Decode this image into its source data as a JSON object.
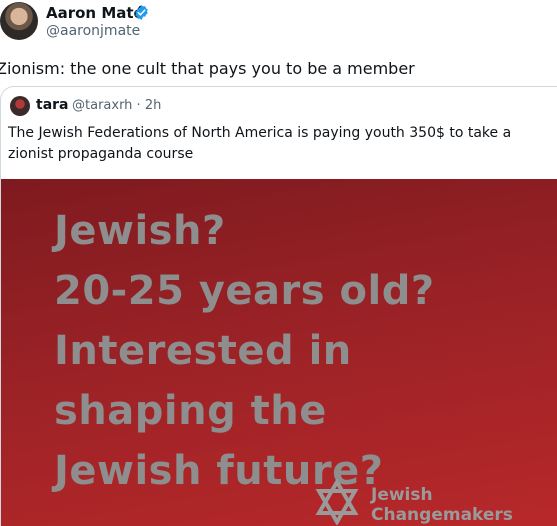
{
  "post": {
    "author_name": "Aaron Maté",
    "author_handle": "@aaronjmate",
    "text": "Zionism: the one cult that pays you to be a member"
  },
  "quote": {
    "author_name": "tara",
    "author_handle": "@taraxrh · 2h",
    "text": "The Jewish Federations of North America is paying youth 350$ to take a zionist propaganda course"
  },
  "media": {
    "headline_lines": [
      "Jewish?",
      "20-25 years old?",
      "Interested in",
      "shaping the",
      "Jewish future?"
    ],
    "brand_lines": [
      "Jewish",
      "Changemakers"
    ]
  },
  "colors": {
    "verified": "#1d9bf0",
    "media_background": "#9a2226",
    "headline_text": "#8e8e8e"
  },
  "icons": {
    "verified": "verified-badge-icon",
    "brand_logo": "star-of-david-logo-icon"
  }
}
